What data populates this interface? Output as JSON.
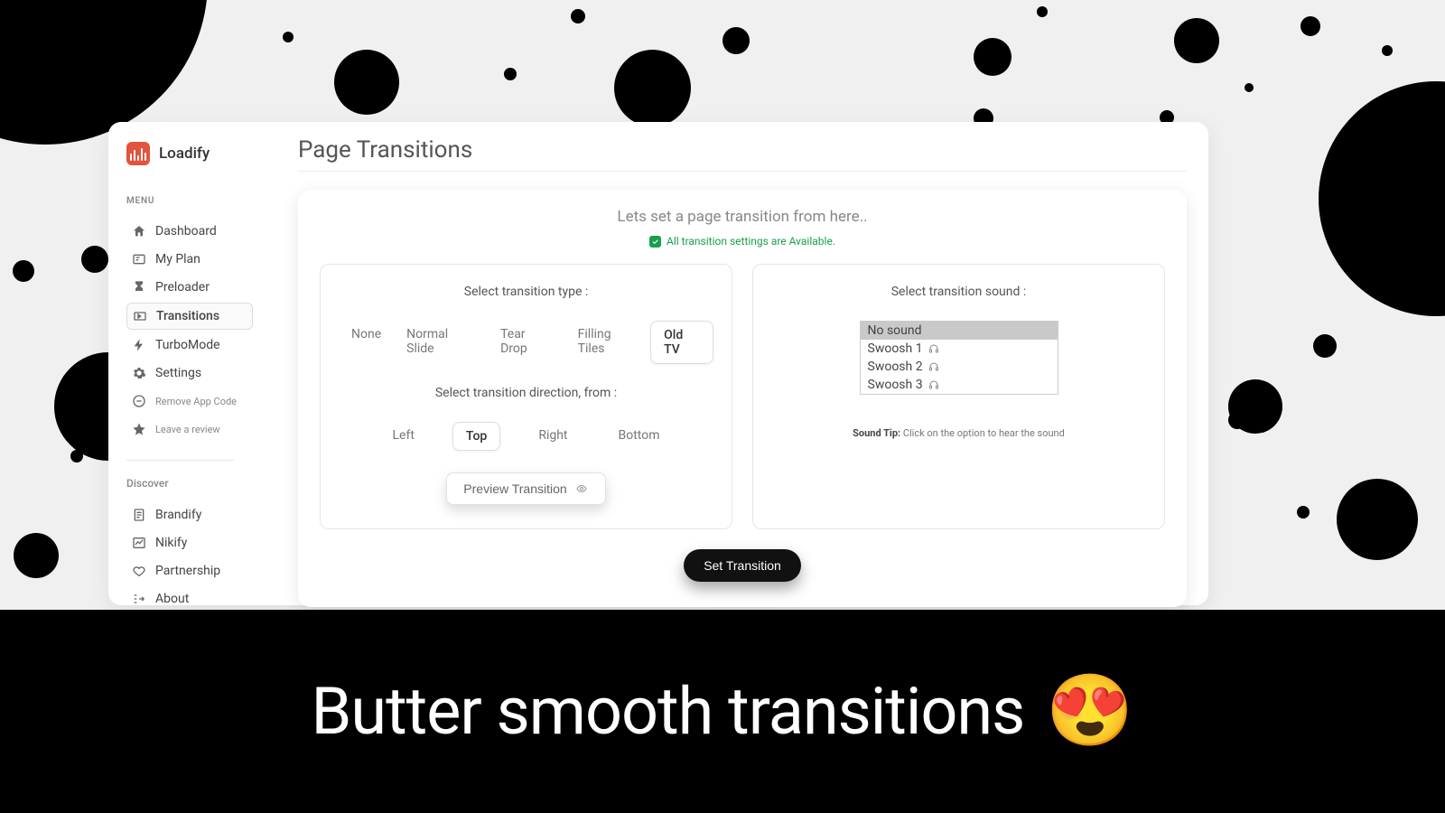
{
  "brand": {
    "name": "Loadify"
  },
  "sidebar": {
    "menu_heading": "MENU",
    "items": [
      {
        "label": "Dashboard"
      },
      {
        "label": "My Plan"
      },
      {
        "label": "Preloader"
      },
      {
        "label": "Transitions"
      },
      {
        "label": "TurboMode"
      },
      {
        "label": "Settings"
      },
      {
        "label": "Remove App Code"
      },
      {
        "label": "Leave a review"
      }
    ],
    "discover_heading": "Discover",
    "discover": [
      {
        "label": "Brandify"
      },
      {
        "label": "Nikify"
      },
      {
        "label": "Partnership"
      },
      {
        "label": "About"
      }
    ]
  },
  "page": {
    "title": "Page Transitions",
    "subtitle": "Lets set a page transition from here..",
    "availability": "All transition settings are Available.",
    "type_label": "Select transition type :",
    "types": [
      "None",
      "Normal Slide",
      "Tear Drop",
      "Filling Tiles",
      "Old TV"
    ],
    "selected_type": "Old TV",
    "direction_label": "Select transition direction, from :",
    "directions": [
      "Left",
      "Top",
      "Right",
      "Bottom"
    ],
    "selected_direction": "Top",
    "preview_label": "Preview Transition",
    "sound_label": "Select transition sound :",
    "sounds": [
      "No sound",
      "Swoosh 1",
      "Swoosh 2",
      "Swoosh 3"
    ],
    "selected_sound": "No sound",
    "sound_tip_bold": "Sound Tip:",
    "sound_tip_rest": " Click on the option to hear the sound",
    "set_button": "Set Transition"
  },
  "banner": {
    "text": "Butter smooth transitions",
    "emoji": "😍"
  }
}
